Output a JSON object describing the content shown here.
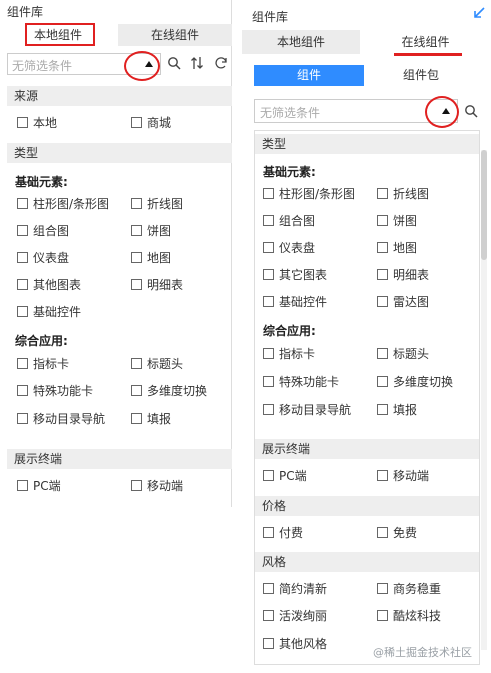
{
  "left": {
    "title": "组件库",
    "tabs": [
      "本地组件",
      "在线组件"
    ],
    "search_placeholder": "无筛选条件",
    "source_header": "来源",
    "source_items": [
      "本地",
      "商城"
    ],
    "type_header": "类型",
    "basic_header": "基础元素:",
    "basic_items": [
      "柱形图/条形图",
      "折线图",
      "组合图",
      "饼图",
      "仪表盘",
      "地图",
      "其他图表",
      "明细表",
      "基础控件"
    ],
    "app_header": "综合应用:",
    "app_items": [
      "指标卡",
      "标题头",
      "特殊功能卡",
      "多维度切换",
      "移动目录导航",
      "填报"
    ],
    "terminal_header": "展示终端",
    "terminal_items": [
      "PC端",
      "移动端"
    ]
  },
  "right": {
    "title": "组件库",
    "tabs": [
      "本地组件",
      "在线组件"
    ],
    "subtabs": [
      "组件",
      "组件包"
    ],
    "search_placeholder": "无筛选条件",
    "type_header": "类型",
    "basic_header": "基础元素:",
    "basic_items": [
      "柱形图/条形图",
      "折线图",
      "组合图",
      "饼图",
      "仪表盘",
      "地图",
      "其它图表",
      "明细表",
      "基础控件",
      "雷达图"
    ],
    "app_header": "综合应用:",
    "app_items": [
      "指标卡",
      "标题头",
      "特殊功能卡",
      "多维度切换",
      "移动目录导航",
      "填报"
    ],
    "terminal_header": "展示终端",
    "terminal_items": [
      "PC端",
      "移动端"
    ],
    "price_header": "价格",
    "price_items": [
      "付费",
      "免费"
    ],
    "style_header": "风格",
    "style_items": [
      "简约清新",
      "商务稳重",
      "活泼绚丽",
      "酷炫科技",
      "其他风格"
    ]
  },
  "watermark": "@稀土掘金技术社区",
  "colors": {
    "accent_blue": "#2f8cff",
    "highlight_red": "#e02020",
    "section_bg": "#eeeeee",
    "tab_bg": "#ececec"
  }
}
